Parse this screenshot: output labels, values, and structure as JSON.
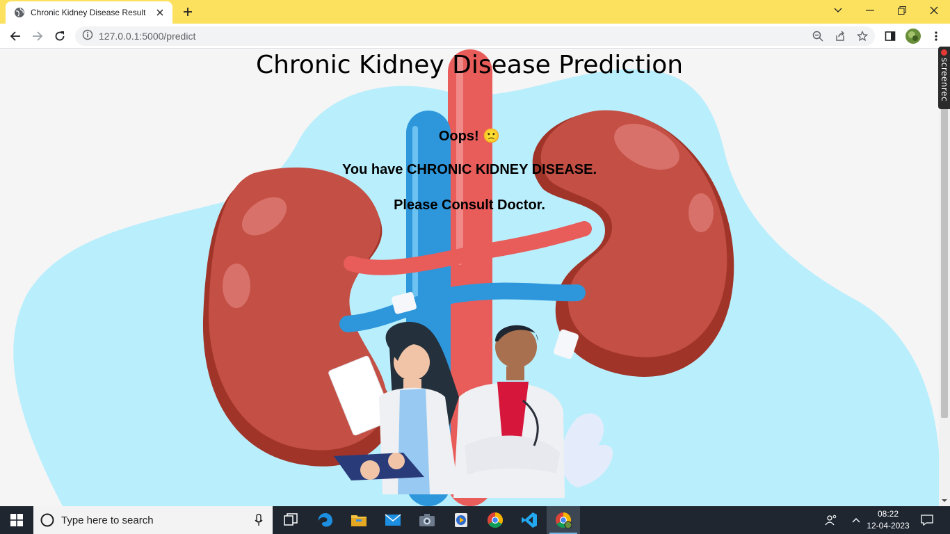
{
  "browser": {
    "tab_title": "Chronic Kidney Disease Result",
    "url": "127.0.0.1:5000/predict",
    "colors": {
      "titlebar": "#fbe15e",
      "toolbar": "#ffffff",
      "omnibox": "#f1f3f4"
    }
  },
  "page": {
    "title": "Chronic Kidney Disease Prediction",
    "result": {
      "line1": "Oops! 🙁",
      "line2": "You have CHRONIC KIDNEY DISEASE.",
      "line3": "Please Consult Doctor."
    },
    "colors": {
      "blob": "#b9eefc",
      "kidney": "#c44f44",
      "kidney_dark": "#a03429",
      "artery": "#e85c5a",
      "vein": "#2e97db"
    }
  },
  "overlay": {
    "screenrec_label": "screenrec"
  },
  "taskbar": {
    "search_placeholder": "Type here to search",
    "apps": [
      "task-view",
      "edge",
      "file-explorer",
      "mail",
      "camera",
      "media-player",
      "chrome",
      "vscode",
      "chrome-active"
    ],
    "time": "08:22",
    "date": "12-04-2023"
  }
}
